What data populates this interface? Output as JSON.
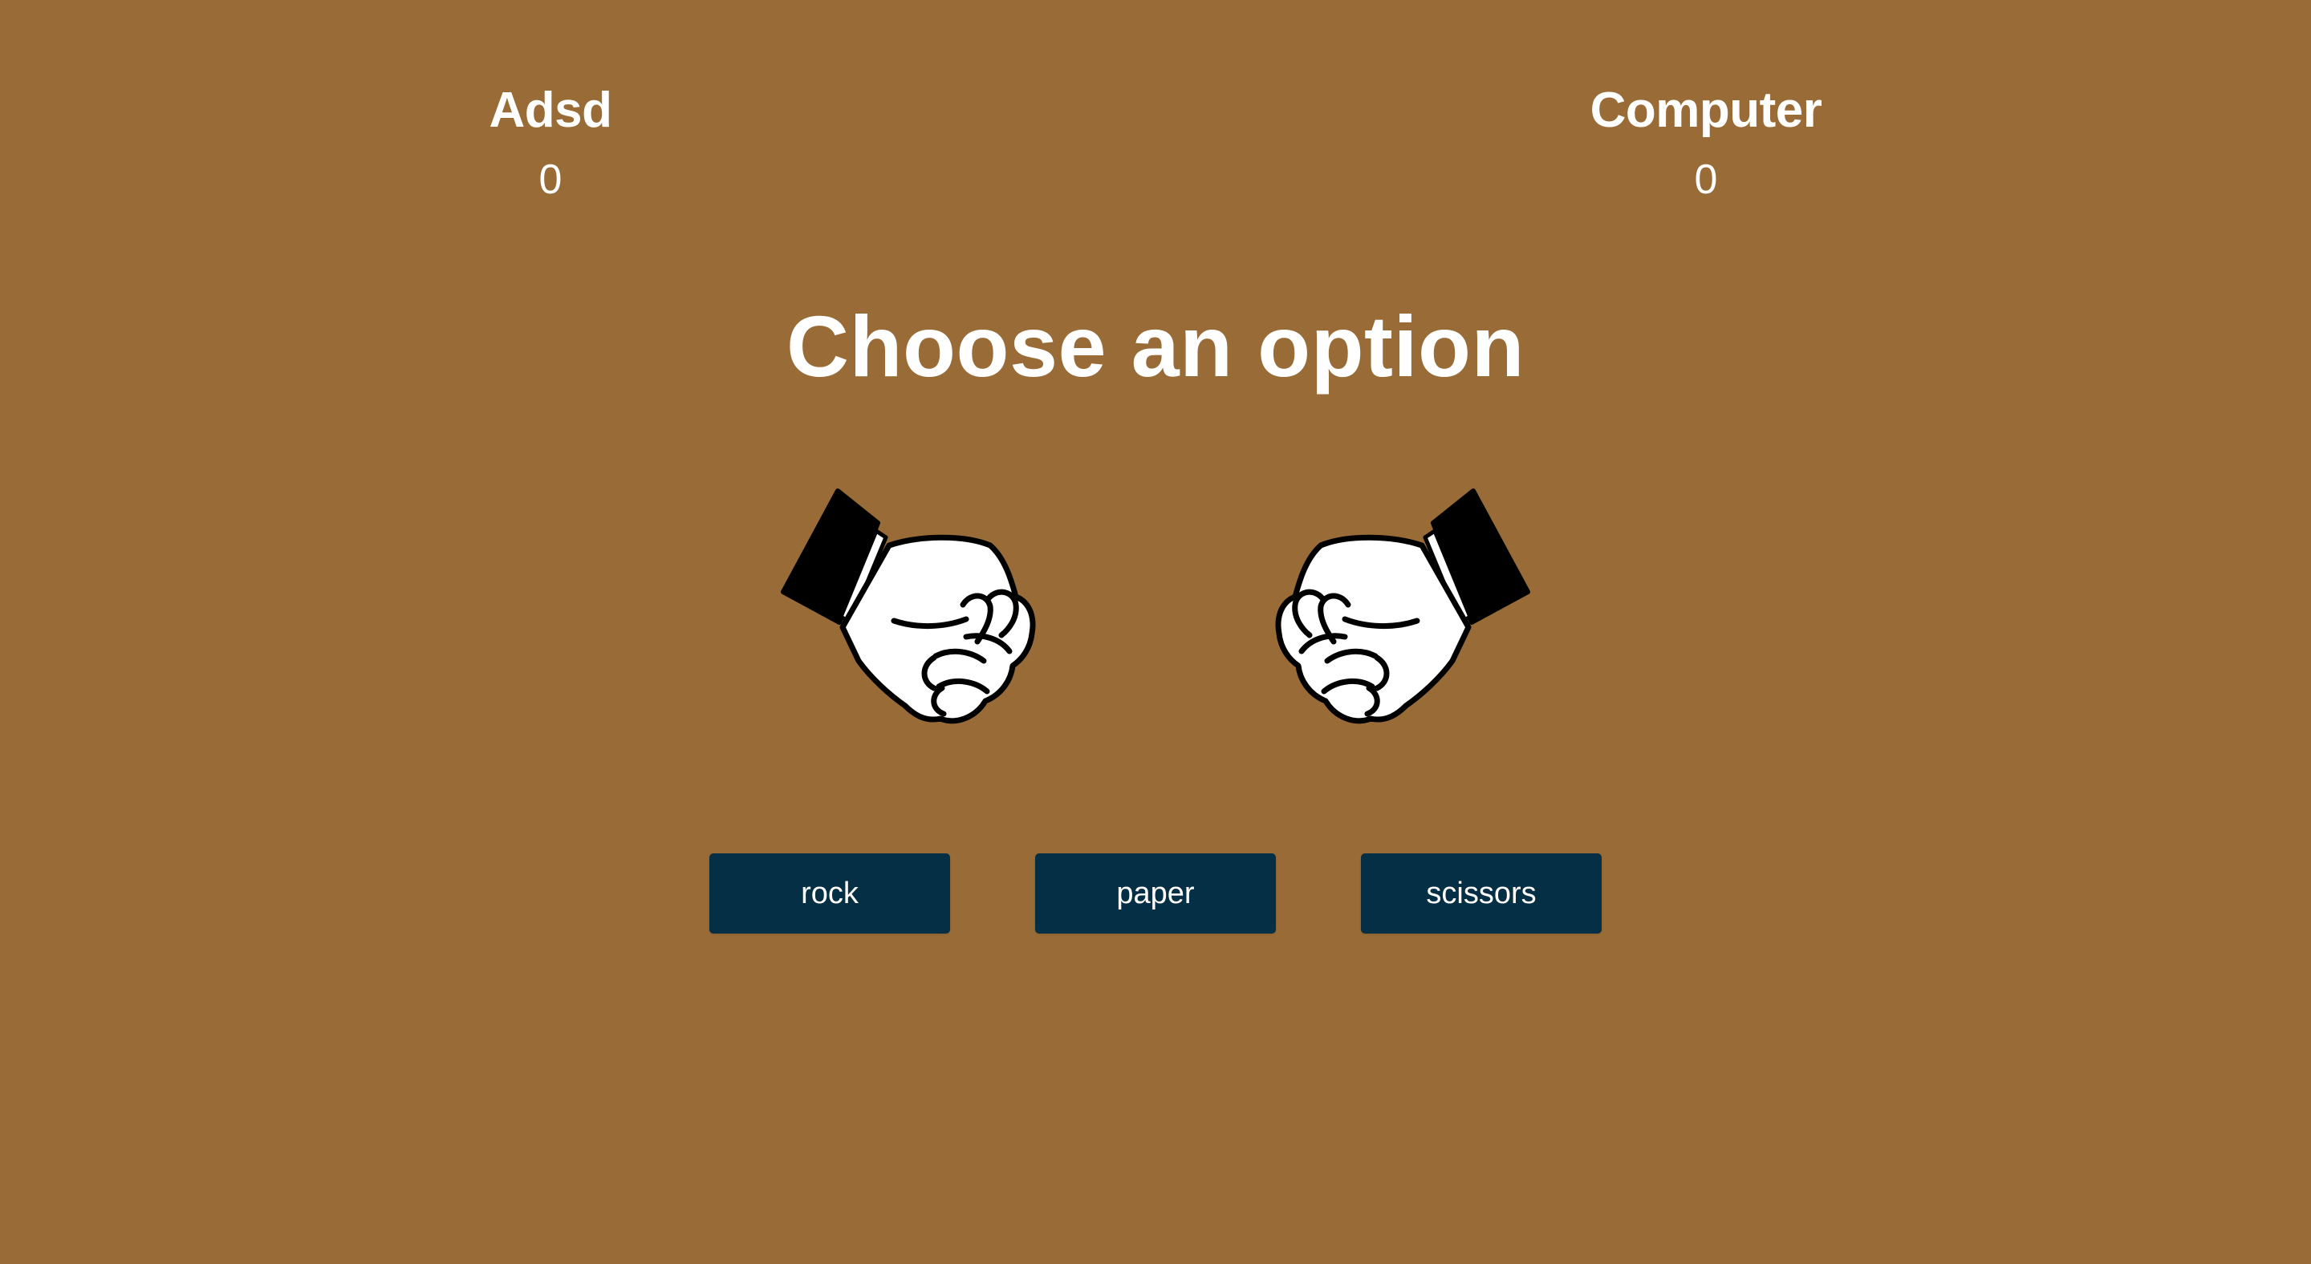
{
  "scoreboard": {
    "player": {
      "name": "Adsd",
      "score": "0"
    },
    "computer": {
      "name": "Computer",
      "score": "0"
    }
  },
  "headline": "Choose an option",
  "hands": {
    "player": {
      "icon": "fist-hand-icon"
    },
    "computer": {
      "icon": "fist-hand-icon"
    }
  },
  "choices": [
    {
      "label": "rock"
    },
    {
      "label": "paper"
    },
    {
      "label": "scissors"
    }
  ],
  "colors": {
    "background": "#996c37",
    "button": "#052f44",
    "text": "#ffffff"
  }
}
